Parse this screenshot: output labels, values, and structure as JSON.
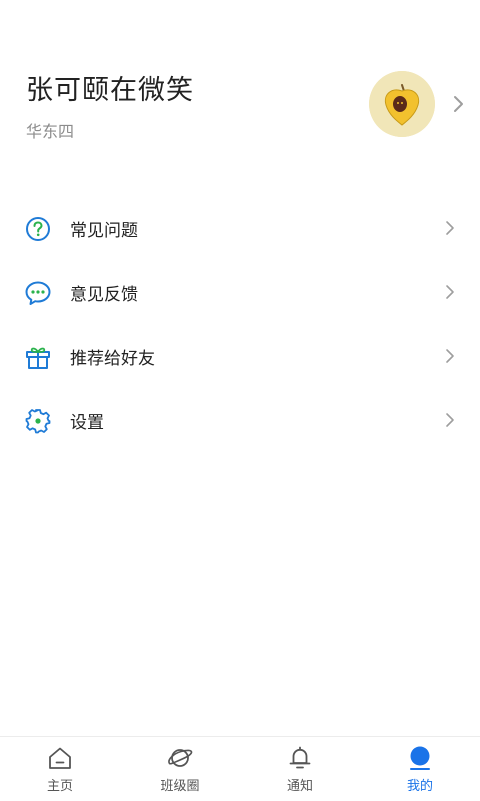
{
  "profile": {
    "name": "张可颐在微笑",
    "subtitle": "华东四"
  },
  "menu": {
    "items": [
      {
        "label": "常见问题",
        "icon": "question-circle-icon"
      },
      {
        "label": "意见反馈",
        "icon": "chat-bubble-icon"
      },
      {
        "label": "推荐给好友",
        "icon": "gift-icon"
      },
      {
        "label": "设置",
        "icon": "gear-icon"
      }
    ]
  },
  "tabbar": {
    "tabs": [
      {
        "label": "主页",
        "icon": "home-icon",
        "active": false
      },
      {
        "label": "班级圈",
        "icon": "planet-icon",
        "active": false
      },
      {
        "label": "通知",
        "icon": "bell-icon",
        "active": false
      },
      {
        "label": "我的",
        "icon": "person-icon",
        "active": true
      }
    ]
  },
  "colors": {
    "accent": "#1a73e8",
    "menu_icon": "#1f7bd6",
    "icon_green": "#2bb24c",
    "secondary_text": "#8c8c8c",
    "avatar_bg": "#f1e6b8"
  }
}
